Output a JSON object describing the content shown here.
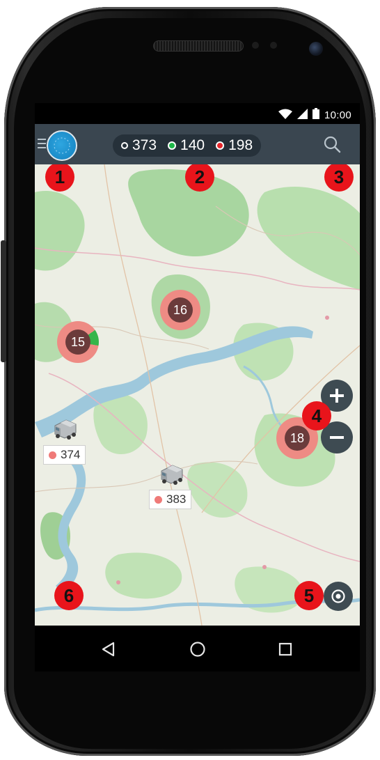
{
  "status_bar": {
    "time": "10:00"
  },
  "app_bar": {
    "menu_icon": "hamburger-icon",
    "logo_icon": "app-logo-icon",
    "search_icon": "search-icon",
    "counters": [
      {
        "value": "373",
        "dot_color": "#ffffff",
        "dot_style": "ring"
      },
      {
        "value": "140",
        "dot_color": "#1fb84a",
        "dot_style": "filled"
      },
      {
        "value": "198",
        "dot_color": "#e5262b",
        "dot_style": "filled"
      }
    ]
  },
  "map": {
    "clusters": [
      {
        "count": "16"
      },
      {
        "count": "15"
      },
      {
        "count": "18"
      }
    ],
    "vehicles": [
      {
        "label": "374",
        "status_color": "#ef7a78"
      },
      {
        "label": "383",
        "status_color": "#ef7a78"
      }
    ],
    "controls": {
      "zoom_in_icon": "plus-icon",
      "zoom_out_icon": "minus-icon",
      "locate_icon": "my-location-icon"
    }
  },
  "callouts": [
    "1",
    "2",
    "3",
    "4",
    "5",
    "6"
  ],
  "nav_bar": {
    "back_icon": "back-triangle-icon",
    "home_icon": "home-circle-icon",
    "recents_icon": "recents-square-icon"
  },
  "colors": {
    "app_bar": "#3a4650",
    "callout_badge": "#e8141b",
    "cluster_ring": "#ee8b84",
    "cluster_core": "#6b3b3b"
  }
}
